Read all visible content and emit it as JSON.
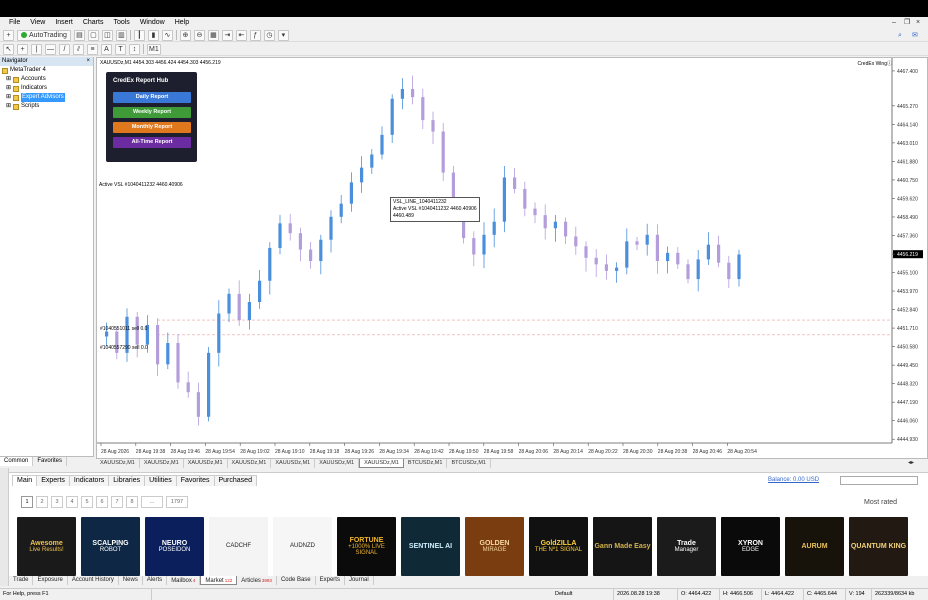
{
  "menu": [
    "File",
    "View",
    "Insert",
    "Charts",
    "Tools",
    "Window",
    "Help"
  ],
  "toolbar": {
    "autotrading_label": "AutoTrading",
    "timeframe_button": "M1"
  },
  "navigator": {
    "title": "Navigator",
    "close": "×",
    "root": "MetaTrader 4",
    "items": [
      {
        "label": "Accounts",
        "selected": false
      },
      {
        "label": "Indicators",
        "selected": false
      },
      {
        "label": "Expert Advisors",
        "selected": true
      },
      {
        "label": "Scripts",
        "selected": false
      }
    ],
    "tabs": [
      "Common",
      "Favorites"
    ]
  },
  "chart": {
    "header": "XAUUSDz,M1  4454.303 4456.424 4454.303 4456.219",
    "broker": "CredEx Wingⓘ",
    "hub_title": "CredEx Report Hub",
    "hub_buttons": [
      {
        "label": "Daily Report",
        "color": "#3a78d8"
      },
      {
        "label": "Weekly Report",
        "color": "#3f9a38"
      },
      {
        "label": "Monthly Report",
        "color": "#e0781e"
      },
      {
        "label": "All-Time Report",
        "color": "#6a2ca0"
      }
    ],
    "active_vsl_label": "Active VSL #1040411232 4460.40906",
    "line_label_1": "#1040551011 sell 0.0",
    "line_label_2": "#1040557290 sell 0.0",
    "tooltip": [
      "VSL_LINE_1040411232",
      "Active VSL #1040411232 4460.40906",
      "4460.489"
    ],
    "current_price": "4456.219"
  },
  "chart_data": {
    "type": "candlestick",
    "y_ticks": [
      "4467.400",
      "4465.270",
      "4464.140",
      "4463.010",
      "4461.880",
      "4460.750",
      "4459.620",
      "4458.490",
      "4457.360",
      "4456.219",
      "4455.100",
      "4453.970",
      "4452.840",
      "4451.710",
      "4450.580",
      "4449.450",
      "4448.320",
      "4447.190",
      "4446.060",
      "4444.930"
    ],
    "ylim": [
      4444.7,
      4467.7
    ],
    "x_ticks": [
      "28 Aug 2026",
      "28 Aug 19:38",
      "28 Aug 19:46",
      "28 Aug 19:54",
      "28 Aug 19:02",
      "28 Aug 19:10",
      "28 Aug 19:18",
      "28 Aug 19:26",
      "28 Aug 19:34",
      "28 Aug 19:42",
      "28 Aug 19:50",
      "28 Aug 19:58",
      "28 Aug 20:06",
      "28 Aug 20:14",
      "28 Aug 20:22",
      "28 Aug 20:30",
      "28 Aug 20:38",
      "28 Aug 20:46",
      "28 Aug 20:54"
    ],
    "close_path": [
      4451.5,
      4450.2,
      4452.4,
      4450.7,
      4451.9,
      4449.5,
      4450.8,
      4448.4,
      4447.8,
      4446.3,
      4450.2,
      4452.6,
      4453.8,
      4452.2,
      4453.3,
      4454.6,
      4456.6,
      4458.1,
      4457.5,
      4456.5,
      4455.8,
      4457.1,
      4458.5,
      4459.3,
      4460.6,
      4461.5,
      4462.3,
      4463.5,
      4465.7,
      4466.3,
      4465.8,
      4464.4,
      4463.7,
      4461.2,
      4458.6,
      4457.2,
      4456.2,
      4457.4,
      4458.2,
      4460.9,
      4460.2,
      4459.0,
      4458.6,
      4457.8,
      4458.2,
      4457.3,
      4456.7,
      4456.0,
      4455.6,
      4455.2,
      4455.4,
      4457.0,
      4456.8,
      4457.4,
      4455.8,
      4456.3,
      4455.6,
      4454.7,
      4455.9,
      4456.8,
      4455.7,
      4454.7,
      4456.2
    ],
    "levels": [
      4452.2,
      4451.3
    ]
  },
  "chart_tabs": [
    {
      "label": "XAUUSDz,M1",
      "active": false
    },
    {
      "label": "XAUUSDz,M1",
      "active": false
    },
    {
      "label": "XAUUSDz,M1",
      "active": false
    },
    {
      "label": "XAUUSDz,M1",
      "active": false
    },
    {
      "label": "XAUUSDz,M1",
      "active": false
    },
    {
      "label": "XAUUSDz,M1",
      "active": false
    },
    {
      "label": "XAUUSDz,M1",
      "active": true
    },
    {
      "label": "BTCUSDz,M1",
      "active": false
    },
    {
      "label": "BTCUSDz,M1",
      "active": false
    }
  ],
  "market": {
    "tabs": [
      "Main",
      "Experts",
      "Indicators",
      "Libraries",
      "Utilities",
      "Favorites",
      "Purchased"
    ],
    "balance": "Balance: 0.00 USD",
    "pages": [
      "1",
      "2",
      "3",
      "4",
      "5",
      "6",
      "7",
      "8",
      "...",
      "1797"
    ],
    "sort_label": "Most rated",
    "products": [
      {
        "title": "Awesome",
        "subtitle": "Live Results!",
        "bg": "#1a1a1a",
        "color": "#f2c14e"
      },
      {
        "title": "SCALPING",
        "subtitle": "ROBOT",
        "bg": "#0d2744",
        "color": "#ffffff"
      },
      {
        "title": "NEURO",
        "subtitle": "POSEIDON",
        "bg": "#0a1f5c",
        "color": "#ffffff"
      },
      {
        "title": "",
        "subtitle": "CADCHF",
        "bg": "#f4f4f4",
        "color": "#222222"
      },
      {
        "title": "",
        "subtitle": "AUDNZD",
        "bg": "#f6f6f6",
        "color": "#222222"
      },
      {
        "title": "FORTUNE",
        "subtitle": "+1000% LIVE SIGNAL",
        "bg": "#0b0b0b",
        "color": "#f0b52b"
      },
      {
        "title": "SENTINEL AI",
        "subtitle": "",
        "bg": "#0f2a36",
        "color": "#cfefff"
      },
      {
        "title": "GOLDEN",
        "subtitle": "MIRAGE",
        "bg": "#7a3d10",
        "color": "#f8d9a0"
      },
      {
        "title": "GoldZILLA",
        "subtitle": "THE Nº1 SIGNAL",
        "bg": "#111111",
        "color": "#ffd23a"
      },
      {
        "title": "Gann Made Easy",
        "subtitle": "",
        "bg": "#151515",
        "color": "#d4b24c"
      },
      {
        "title": "Trade",
        "subtitle": "Manager",
        "bg": "#1b1b1b",
        "color": "#ffffff"
      },
      {
        "title": "XYRON",
        "subtitle": "EDGE",
        "bg": "#0a0a0a",
        "color": "#ffffff"
      },
      {
        "title": "AURUM",
        "subtitle": "",
        "bg": "#17120a",
        "color": "#e8c15a"
      },
      {
        "title": "QUANTUM KING",
        "subtitle": "",
        "bg": "#221a12",
        "color": "#f3d27a"
      }
    ]
  },
  "terminal_tabs": [
    {
      "label": "Trade",
      "badge": ""
    },
    {
      "label": "Exposure",
      "badge": ""
    },
    {
      "label": "Account History",
      "badge": ""
    },
    {
      "label": "News",
      "badge": ""
    },
    {
      "label": "Alerts",
      "badge": ""
    },
    {
      "label": "Mailbox",
      "badge": "4"
    },
    {
      "label": "Market",
      "badge": "122"
    },
    {
      "label": "Articles",
      "badge": "3993"
    },
    {
      "label": "Code Base",
      "badge": ""
    },
    {
      "label": "Experts",
      "badge": ""
    },
    {
      "label": "Journal",
      "badge": ""
    }
  ],
  "status": {
    "help": "For Help, press F1",
    "profile": "Default",
    "datetime": "2026.08.28 19:38",
    "open": "O: 4464.422",
    "high": "H: 4466.506",
    "low": "L: 4464.422",
    "close": "C: 4465.644",
    "volume": "V: 194",
    "traffic": "262339/8634 kb"
  },
  "colors": {
    "bull": "#4a8fdb",
    "bear": "#b39ddb",
    "level": "#e8a0a0"
  }
}
